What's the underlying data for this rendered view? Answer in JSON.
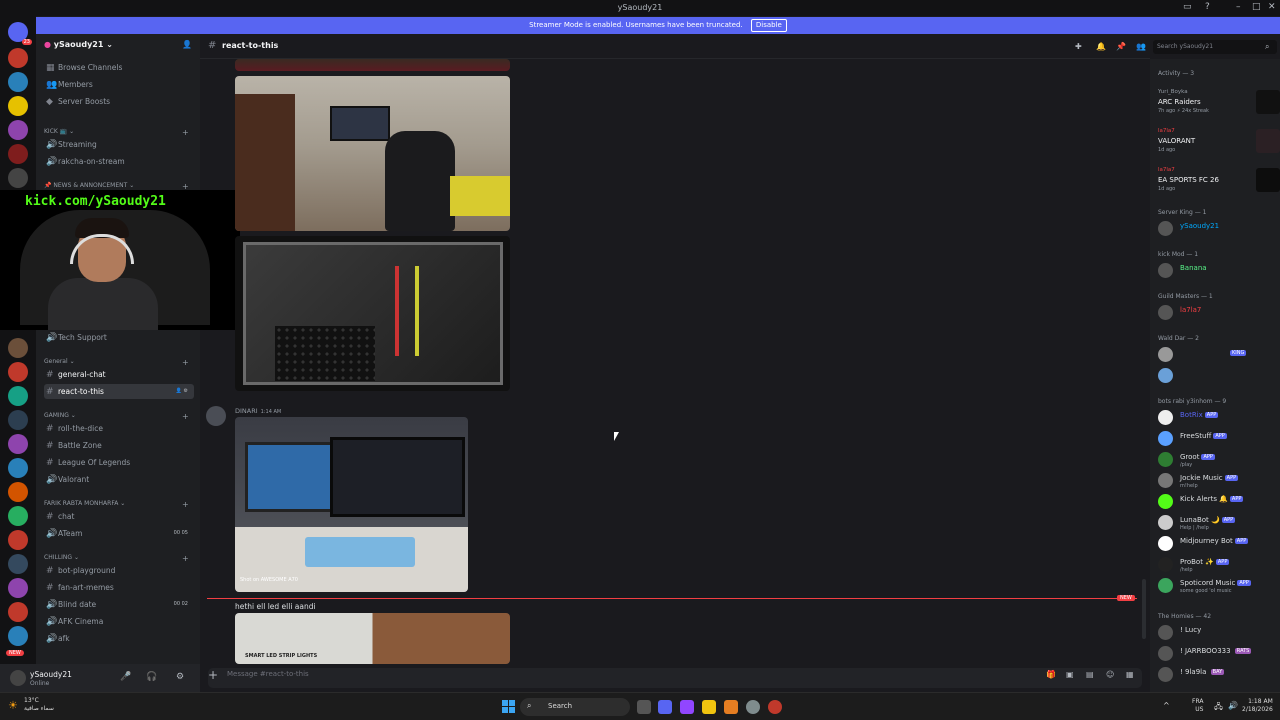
{
  "window": {
    "title": "ySaoudy21"
  },
  "banner": {
    "text": "Streamer Mode is enabled. Usernames have been truncated.",
    "button": "Disable"
  },
  "server_badges": [
    "23",
    "NEW"
  ],
  "sidebar": {
    "guild_name": "ySaoudy21",
    "top_items": [
      "Browse Channels",
      "Members",
      "Server Boosts"
    ],
    "categories": {
      "kick": "KICK 📺",
      "news": "NEWS & ANNONCEMENT",
      "general": "General",
      "gaming": "GAMING",
      "farik": "FARIK RABTA MONHARFA",
      "chilling": "CHILLING"
    },
    "channels": {
      "streaming": "Streaming",
      "rakcha": "rakcha-on-stream",
      "tech_support": "Tech Support",
      "general_chat": "general-chat",
      "react": "react-to-this",
      "roll": "roll-the-dice",
      "battle": "Battle Zone",
      "lol": "League Of Legends",
      "valorant": "Valorant",
      "chat": "chat",
      "ateam": "ATeam",
      "bot_playground": "bot-playground",
      "fan_art": "fan-art-memes",
      "blind_date": "Blind date",
      "afk_cinema": "AFK Cinema",
      "afk": "afk"
    },
    "ateam_badge": "00 05",
    "blind_badge": "00 02"
  },
  "webcam": {
    "overlay": "kick.com/ySaoudy21"
  },
  "user": {
    "name": "ySaoudy21",
    "status": "Online"
  },
  "header": {
    "channel": "react-to-this",
    "search_placeholder": "Search ySaoudy21"
  },
  "messages": {
    "author": "DINARI",
    "time": "1:14 AM",
    "caption_overlay": "Shot on AWESOME A70",
    "text": "hethi ell led elli aandi",
    "new_label": "NEW",
    "photo_caption": "SMART LED STRIP LIGHTS"
  },
  "input": {
    "placeholder": "Message #react-to-this"
  },
  "members": {
    "activity_header": "Activity — 3",
    "activities": [
      {
        "who": "Yuri_Boyka",
        "game": "ARC Raiders",
        "meta": "7h ago  ⚡ 24x Streak"
      },
      {
        "who": "la7la7",
        "game": "VALORANT",
        "meta": "1d ago"
      },
      {
        "who": "la7la7",
        "game": "EA SPORTS FC 26",
        "meta": "1d ago"
      }
    ],
    "server_king_header": "Server King — 1",
    "server_king": "ySaoudy21",
    "kick_mod_header": "kick Mod — 1",
    "kick_mod": "Banana",
    "guild_masters_header": "Guild Masters — 1",
    "guild_master": "la7la7",
    "wald_dar_header": "Wald Dar — 2",
    "king_tag": "KING",
    "bots_header": "bots rabi y3inhom — 9",
    "bots": [
      {
        "name": "BotRix",
        "sub": ""
      },
      {
        "name": "FreeStuff",
        "sub": ""
      },
      {
        "name": "Groot",
        "sub": "/play"
      },
      {
        "name": "Jockie Music",
        "sub": "m!help"
      },
      {
        "name": "Kick Alerts 🔔",
        "sub": ""
      },
      {
        "name": "LunaBot 🌙",
        "sub": "Help | /help"
      },
      {
        "name": "Midjourney Bot",
        "sub": ""
      },
      {
        "name": "ProBot ✨",
        "sub": "/help"
      },
      {
        "name": "Spoticord Music",
        "sub": "some good 'ol music"
      }
    ],
    "app_tag": "APP",
    "homies_header": "The Homies — 42",
    "homies": [
      "! Lucy",
      "! JARRBOO333",
      "! 9la9la"
    ],
    "homie_tags": [
      "",
      "RATS",
      "BAY"
    ]
  },
  "taskbar": {
    "search": "Search",
    "weather_temp": "13°C",
    "weather_desc": "سماء صافية",
    "lang1": "FRA",
    "lang2": "US",
    "time": "1:18 AM",
    "date": "2/18/2026"
  }
}
